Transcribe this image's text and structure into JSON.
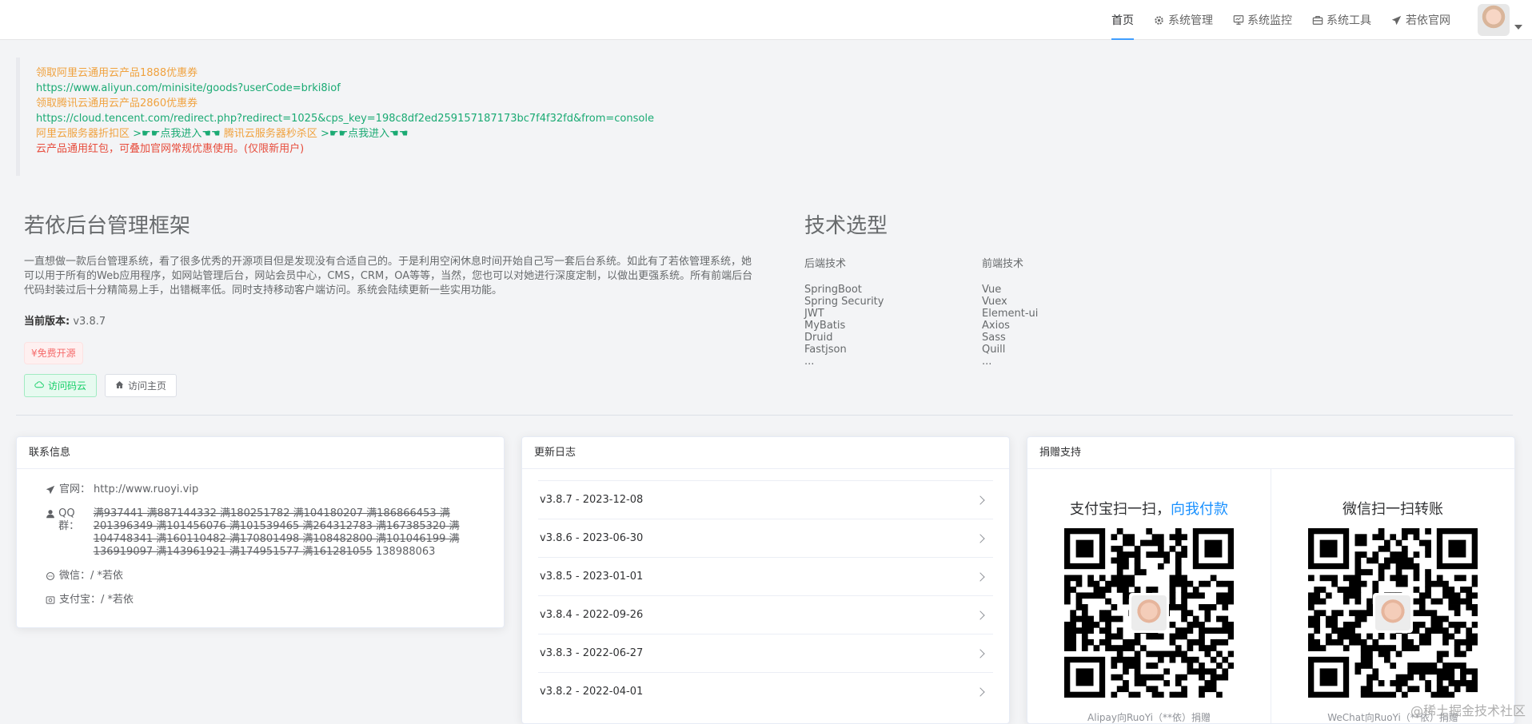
{
  "nav": {
    "items": [
      {
        "label": "首页",
        "icon": "",
        "active": true
      },
      {
        "label": "系统管理",
        "icon": "gear-icon"
      },
      {
        "label": "系统监控",
        "icon": "monitor-icon"
      },
      {
        "label": "系统工具",
        "icon": "toolbox-icon"
      },
      {
        "label": "若依官网",
        "icon": "paper-plane-icon"
      }
    ]
  },
  "ad": {
    "line1": "领取阿里云通用云产品1888优惠券",
    "line2": "https://www.aliyun.com/minisite/goods?userCode=brki8iof",
    "line3": "领取腾讯云通用云产品2860优惠券",
    "line4": "https://cloud.tencent.com/redirect.php?redirect=1025&cps_key=198c8df2ed259157187173bc7f4f32fd&from=console",
    "line5a": "阿里云服务器折扣区",
    "line5b": ">☛☛点我进入☚☚",
    "line5c": "腾讯云服务器秒杀区",
    "line5d": ">☛☛点我进入☚☚",
    "line6": "云产品通用红包，可叠加官网常规优惠使用。(仅限新用户)"
  },
  "intro": {
    "title": "若依后台管理框架",
    "desc": "一直想做一款后台管理系统，看了很多优秀的开源项目但是发现没有合适自己的。于是利用空闲休息时间开始自己写一套后台系统。如此有了若依管理系统，她可以用于所有的Web应用程序，如网站管理后台，网站会员中心，CMS，CRM，OA等等，当然，您也可以对她进行深度定制，以做出更强系统。所有前端后台代码封装过后十分精简易上手，出错概率低。同时支持移动客户端访问。系统会陆续更新一些实用功能。",
    "version_label": "当前版本:",
    "version": "v3.8.7",
    "tag": "¥免费开源",
    "btn_gitee": "访问码云",
    "btn_home": "访问主页"
  },
  "tech": {
    "title": "技术选型",
    "backend_title": "后端技术",
    "backend": [
      "SpringBoot",
      "Spring Security",
      "JWT",
      "MyBatis",
      "Druid",
      "Fastjson",
      "..."
    ],
    "frontend_title": "前端技术",
    "frontend": [
      "Vue",
      "Vuex",
      "Element-ui",
      "Axios",
      "Sass",
      "Quill",
      "..."
    ]
  },
  "contact": {
    "header": "联系信息",
    "site_label": "官网：",
    "site": "http://www.ruoyi.vip",
    "qq_label": "QQ群：",
    "qq_struck": "满937441 满887144332 满180251782 满104180207 满186866453 满201396349 满101456076 满101539465 满264312783 满167385320 满104748341 满160110482 满170801498 满108482800 满101046199 满136919097 满143961921 满174951577 满161281055",
    "qq_active": "138988063",
    "wechat_label": "微信：",
    "wechat": "/ *若依",
    "alipay_label": "支付宝：",
    "alipay": "/ *若依"
  },
  "changelog": {
    "header": "更新日志",
    "items": [
      "v3.8.7 - 2023-12-08",
      "v3.8.6 - 2023-06-30",
      "v3.8.5 - 2023-01-01",
      "v3.8.4 - 2022-09-26",
      "v3.8.3 - 2022-06-27",
      "v3.8.2 - 2022-04-01"
    ]
  },
  "donate": {
    "header": "捐赠支持",
    "alipay_title_a": "支付宝扫一扫，",
    "alipay_title_b": "向我付款",
    "alipay_caption": "Alipay向RuoYi（**依）捐赠",
    "wechat_title": "微信扫一扫转账",
    "wechat_caption": "WeChat向RuoYi（**依）捐赠"
  },
  "watermark": "@稀土掘金技术社区",
  "colors": {
    "accent": "#409eff",
    "ad_orange": "#f0a23f",
    "ad_green": "#1aaa73",
    "ad_red": "#e74c3c"
  }
}
